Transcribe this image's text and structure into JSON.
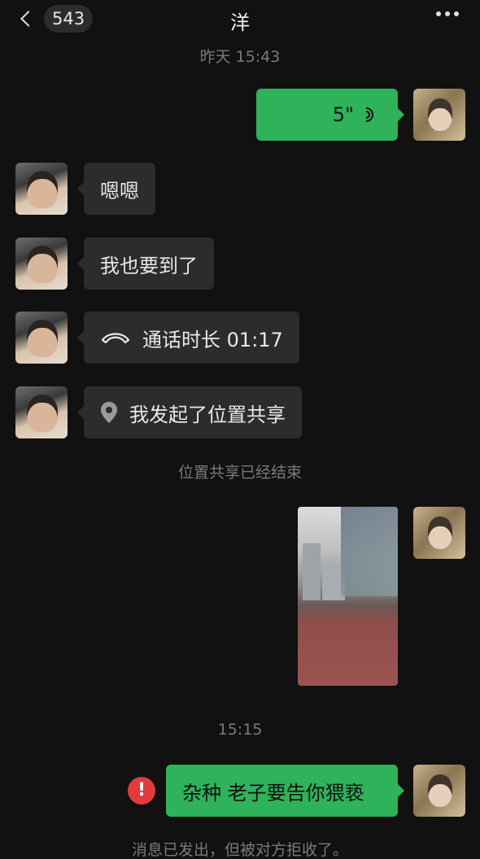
{
  "header": {
    "unread_count": "543",
    "title": "洋"
  },
  "timestamps": {
    "first": "昨天 15:43",
    "second": "15:15"
  },
  "messages": {
    "voice_duration": "5\"",
    "m1": "嗯嗯",
    "m2": "我也要到了",
    "call_label": "通话时长 01:17",
    "location_label": "我发起了位置共享",
    "final_text": "杂种 老子要告你猥亵"
  },
  "system": {
    "location_ended": "位置共享已经结束",
    "rejected": "消息已发出，但被对方拒收了。"
  },
  "colors": {
    "sent_bubble": "#2eb25a",
    "recv_bubble": "#2c2c2c",
    "error": "#e23b3b"
  }
}
